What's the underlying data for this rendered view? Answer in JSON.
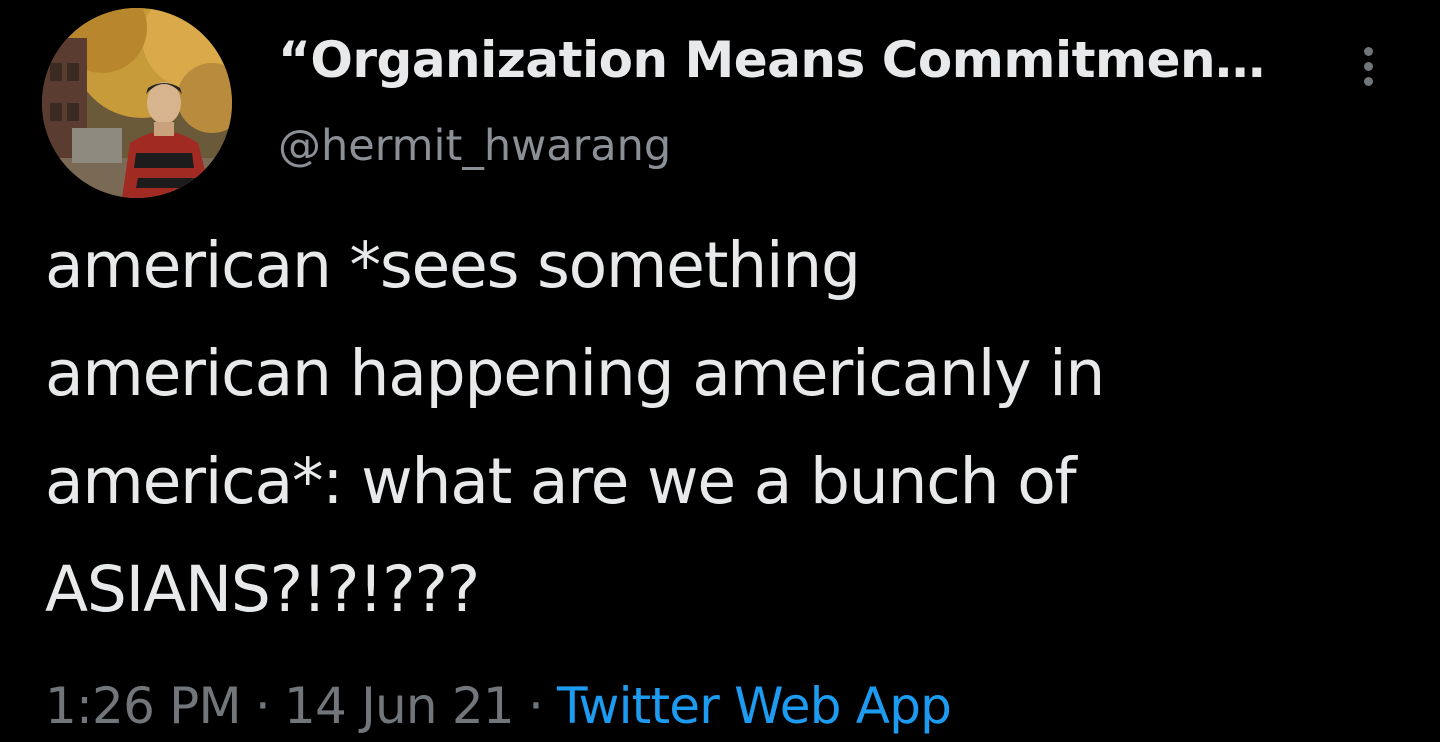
{
  "author": {
    "display_name": "“Organization Means Commitmen…",
    "handle": "@hermit_hwarang",
    "avatar_icon": "avatar-photo-autumn-tree"
  },
  "tweet": {
    "lines": [
      "american *sees something",
      "american happening americanly in",
      "america*: what are we a bunch of",
      "ASIANS?!?!???"
    ]
  },
  "meta": {
    "time": "1:26 PM",
    "separator": "·",
    "date": "14 Jun 21",
    "source": "Twitter Web App"
  },
  "menu": {
    "more_icon": "vertical-ellipsis-icon"
  },
  "colors": {
    "background": "#000000",
    "text_primary": "#e7e9ea",
    "text_secondary": "#71767b",
    "link": "#1d9bf0"
  }
}
